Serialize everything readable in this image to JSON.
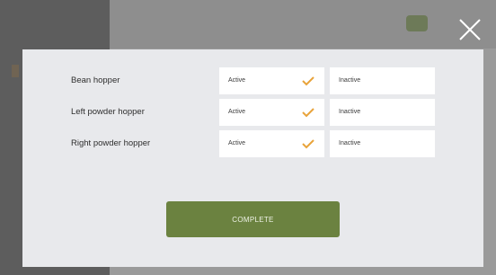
{
  "background": {
    "left_header": "",
    "badge_text": ""
  },
  "modal": {
    "rows": [
      {
        "label": "Bean hopper",
        "active_label": "Active",
        "inactive_label": "Inactive",
        "selected": "active"
      },
      {
        "label": "Left powder hopper",
        "active_label": "Active",
        "inactive_label": "Inactive",
        "selected": "active"
      },
      {
        "label": "Right powder hopper",
        "active_label": "Active",
        "inactive_label": "Inactive",
        "selected": "active"
      }
    ],
    "complete_label": "COMPLETE"
  },
  "colors": {
    "accent_check": "#e8a33a",
    "complete_button": "#6b8240",
    "modal_bg": "#e8e9ec",
    "overlay_bg": "#8b8b8b"
  },
  "icons": {
    "close": "close-icon",
    "check": "check-icon"
  }
}
